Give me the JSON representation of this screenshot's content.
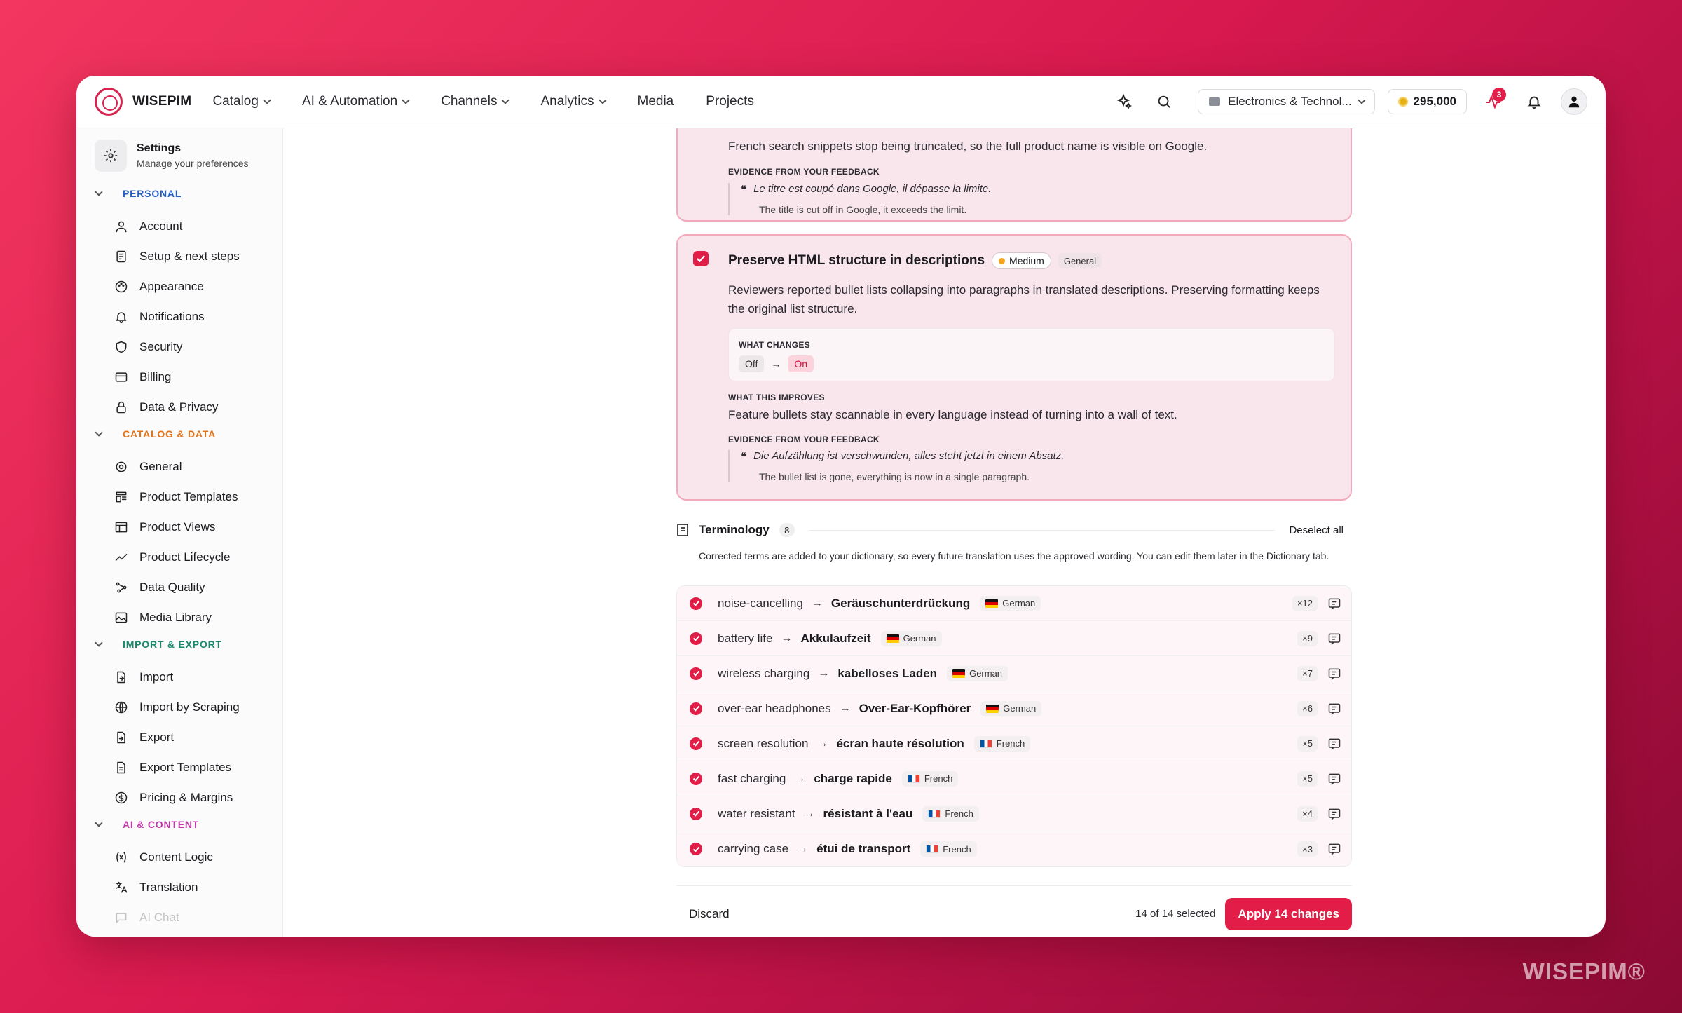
{
  "brand": {
    "name": "WISEPIM",
    "watermark": "WISEPIM®"
  },
  "nav": {
    "items": [
      {
        "label": "Catalog",
        "dropdown": true
      },
      {
        "label": "AI & Automation",
        "dropdown": true
      },
      {
        "label": "Channels",
        "dropdown": true
      },
      {
        "label": "Analytics",
        "dropdown": true
      },
      {
        "label": "Media",
        "dropdown": false
      },
      {
        "label": "Projects",
        "dropdown": false
      }
    ],
    "workspace": "Electronics & Technol...",
    "credits": "295,000",
    "activity_badge": "3"
  },
  "sidebar": {
    "title": "Settings",
    "subtitle": "Manage your preferences",
    "sections": [
      {
        "label": "PERSONAL",
        "items": [
          "Account",
          "Setup & next steps",
          "Appearance",
          "Notifications",
          "Security",
          "Billing",
          "Data & Privacy"
        ]
      },
      {
        "label": "CATALOG & DATA",
        "items": [
          "General",
          "Product Templates",
          "Product Views",
          "Product Lifecycle",
          "Data Quality",
          "Media Library"
        ]
      },
      {
        "label": "IMPORT & EXPORT",
        "items": [
          "Import",
          "Import by Scraping",
          "Export",
          "Export Templates",
          "Pricing & Margins"
        ]
      },
      {
        "label": "AI & CONTENT",
        "items": [
          "Content Logic",
          "Translation",
          "AI Chat"
        ]
      }
    ]
  },
  "card1": {
    "impact": "French search snippets stop being truncated, so the full product name is visible on Google.",
    "evidence_label": "EVIDENCE FROM YOUR FEEDBACK",
    "quote": "Le titre est coupé dans Google, il dépasse la limite.",
    "translation": "The title is cut off in Google, it exceeds the limit."
  },
  "card2": {
    "title": "Preserve HTML structure in descriptions",
    "priority": "Medium",
    "category": "General",
    "description": "Reviewers reported bullet lists collapsing into paragraphs in translated descriptions. Preserving formatting keeps the original list structure.",
    "changes_label": "WHAT CHANGES",
    "from": "Off",
    "to": "On",
    "improves_label": "WHAT THIS IMPROVES",
    "improves": "Feature bullets stay scannable in every language instead of turning into a wall of text.",
    "evidence_label": "EVIDENCE FROM YOUR FEEDBACK",
    "quote": "Die Aufzählung ist verschwunden, alles steht jetzt in einem Absatz.",
    "translation": "The bullet list is gone, everything is now in a single paragraph."
  },
  "terminology": {
    "title": "Terminology",
    "count": "8",
    "deselect": "Deselect all",
    "description": "Corrected terms are added to your dictionary, so every future translation uses the approved wording. You can edit them later in the Dictionary tab.",
    "rows": [
      {
        "source": "noise-cancelling",
        "target": "Geräuschunterdrückung",
        "lang": "German",
        "flag": "de",
        "count": "×12"
      },
      {
        "source": "battery life",
        "target": "Akkulaufzeit",
        "lang": "German",
        "flag": "de",
        "count": "×9"
      },
      {
        "source": "wireless charging",
        "target": "kabelloses Laden",
        "lang": "German",
        "flag": "de",
        "count": "×7"
      },
      {
        "source": "over-ear headphones",
        "target": "Over-Ear-Kopfhörer",
        "lang": "German",
        "flag": "de",
        "count": "×6"
      },
      {
        "source": "screen resolution",
        "target": "écran haute résolution",
        "lang": "French",
        "flag": "fr",
        "count": "×5"
      },
      {
        "source": "fast charging",
        "target": "charge rapide",
        "lang": "French",
        "flag": "fr",
        "count": "×5"
      },
      {
        "source": "water resistant",
        "target": "résistant à l'eau",
        "lang": "French",
        "flag": "fr",
        "count": "×4"
      },
      {
        "source": "carrying case",
        "target": "étui de transport",
        "lang": "French",
        "flag": "fr",
        "count": "×3"
      }
    ]
  },
  "footer": {
    "discard": "Discard",
    "selected": "14 of 14 selected",
    "apply": "Apply 14 changes"
  }
}
